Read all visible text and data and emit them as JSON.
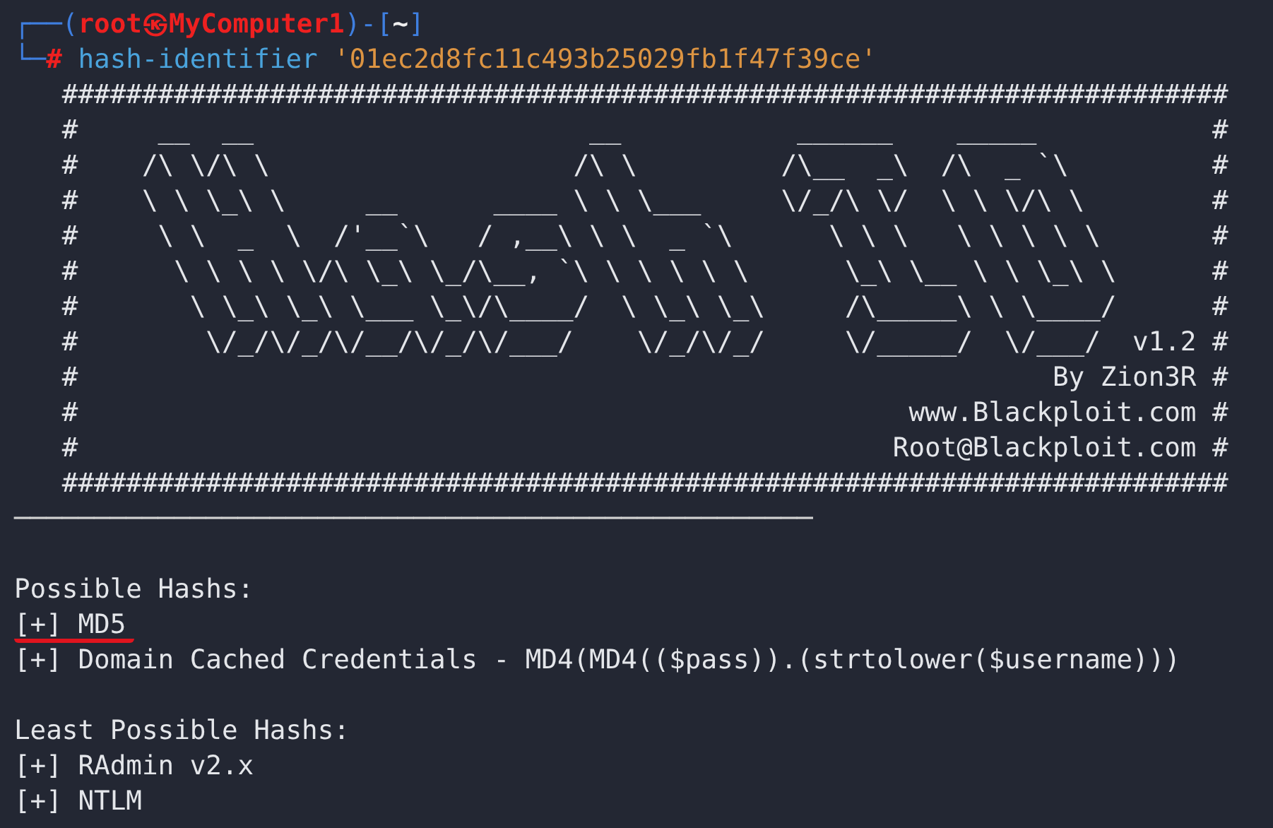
{
  "prompt": {
    "lines": [
      [
        {
          "kind": "frame",
          "text": "┌──("
        },
        {
          "kind": "user",
          "text": "root㉿MyComputer1"
        },
        {
          "kind": "frame",
          "text": ")-["
        },
        {
          "kind": "path",
          "text": "~"
        },
        {
          "kind": "frame",
          "text": "]"
        }
      ],
      [
        {
          "kind": "frame",
          "text": "└─"
        },
        {
          "kind": "symbol",
          "text": "#"
        },
        {
          "kind": "command",
          "text": "hash-identifier"
        },
        {
          "kind": "argument",
          "text": "'01ec2d8fc11c493b25029fb1f47f39ce'"
        }
      ]
    ]
  },
  "banner": {
    "lines": [
      "   #########################################################################",
      "   #     __  __                     __           ______    _____           #",
      "   #    /\\ \\/\\ \\                   /\\ \\         /\\__  _\\  /\\  _ `\\         #",
      "   #    \\ \\ \\_\\ \\     __      ____ \\ \\ \\___     \\/_/\\ \\/  \\ \\ \\/\\ \\        #",
      "   #     \\ \\  _  \\  /'__`\\   / ,__\\ \\ \\  _ `\\      \\ \\ \\   \\ \\ \\ \\ \\       #",
      "   #      \\ \\ \\ \\ \\/\\ \\_\\ \\_/\\__, `\\ \\ \\ \\ \\ \\      \\_\\ \\__ \\ \\ \\_\\ \\      #",
      "   #       \\ \\_\\ \\_\\ \\___ \\_\\/\\____/  \\ \\_\\ \\_\\     /\\_____\\ \\ \\____/      #",
      "   #        \\/_/\\/_/\\/__/\\/_/\\/___/    \\/_/\\/_/     \\/_____/  \\/___/  v1.2 #",
      "   #                                                             By Zion3R #",
      "   #                                                    www.Blackploit.com #",
      "   #                                                   Root@Blackploit.com #",
      "   #########################################################################"
    ]
  },
  "separator": "──────────────────────────────────────────────────",
  "results": [
    {
      "heading": "Possible Hashs:",
      "items": [
        {
          "text": "[+] MD5",
          "highlighted": true
        },
        {
          "text": "[+] Domain Cached Credentials - MD4(MD4(($pass)).(strtolower($username)))",
          "highlighted": false
        }
      ]
    },
    {
      "heading": "Least Possible Hashs:",
      "items": [
        {
          "text": "[+] RAdmin v2.x",
          "highlighted": false
        },
        {
          "text": "[+] NTLM",
          "highlighted": false
        }
      ]
    }
  ]
}
